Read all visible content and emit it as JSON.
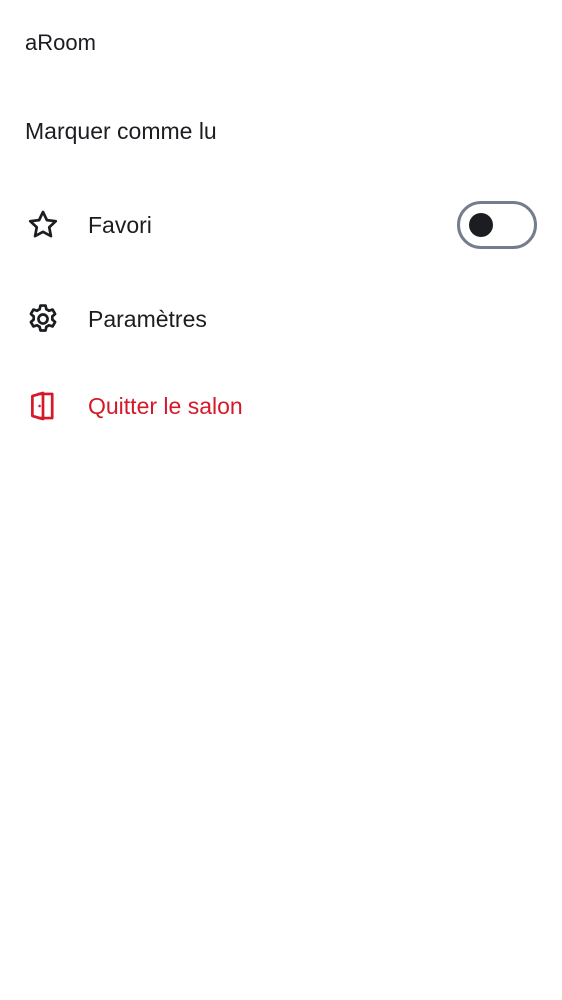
{
  "room": {
    "name": "aRoom"
  },
  "menu": {
    "mark_as_read": {
      "label": "Marquer comme lu"
    },
    "favourite": {
      "label": "Favori",
      "icon": "star-outline-icon",
      "toggle_on": false
    },
    "settings": {
      "label": "Paramètres",
      "icon": "gear-icon"
    },
    "leave": {
      "label": "Quitter le salon",
      "icon": "leave-door-icon"
    }
  },
  "colors": {
    "text": "#1b1d21",
    "danger": "#d51928",
    "toggle_border": "#737d8c",
    "background": "#ffffff"
  }
}
